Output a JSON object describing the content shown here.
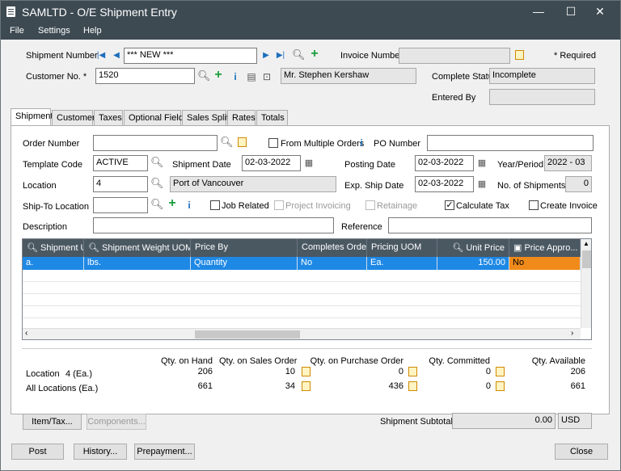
{
  "window": {
    "title": "SAMLTD - O/E Shipment Entry",
    "minimize": "—",
    "maximize": "☐",
    "close": "✕"
  },
  "menu": {
    "file": "File",
    "settings": "Settings",
    "help": "Help"
  },
  "header": {
    "shipment_number_label": "Shipment Number",
    "shipment_number_value": "*** NEW ***",
    "invoice_number_label": "Invoice Number",
    "invoice_number_value": "",
    "required_label": "*  Required",
    "customer_no_label": "Customer No. *",
    "customer_no_value": "1520",
    "customer_name": "Mr. Stephen Kershaw",
    "complete_status_label": "Complete Status",
    "complete_status_value": "Incomplete",
    "entered_by_label": "Entered By",
    "entered_by_value": ""
  },
  "tabs": [
    "Shipment",
    "Customer",
    "Taxes",
    "Optional Fields",
    "Sales Split",
    "Rates",
    "Totals"
  ],
  "form": {
    "order_number_label": "Order Number",
    "order_number_value": "",
    "from_multiple_orders": "From Multiple Orders",
    "po_number_label": "PO Number",
    "po_number_value": "",
    "template_code_label": "Template Code",
    "template_code_value": "ACTIVE",
    "shipment_date_label": "Shipment Date",
    "shipment_date_value": "02-03-2022",
    "posting_date_label": "Posting Date",
    "posting_date_value": "02-03-2022",
    "year_period_label": "Year/Period",
    "year_period_value": "2022 - 03",
    "location_label": "Location",
    "location_value": "4",
    "location_name": "Port of Vancouver",
    "exp_ship_date_label": "Exp. Ship Date",
    "exp_ship_date_value": "02-03-2022",
    "no_shipments_label": "No. of Shipments",
    "no_shipments_value": "0",
    "ship_to_label": "Ship-To Location",
    "ship_to_value": "",
    "job_related": "Job Related",
    "project_invoicing": "Project Invoicing",
    "retainage": "Retainage",
    "calculate_tax": "Calculate Tax",
    "create_invoice": "Create Invoice",
    "description_label": "Description",
    "description_value": "",
    "reference_label": "Reference",
    "reference_value": ""
  },
  "grid": {
    "columns": [
      "Shipment U...",
      "Shipment Weight UOM",
      "Price By",
      "Completes Order",
      "Pricing UOM",
      "Unit Price",
      "Price Appro..."
    ],
    "row": [
      "a.",
      "lbs.",
      "Quantity",
      "No",
      "Ea.",
      "150.00",
      "No"
    ]
  },
  "summary": {
    "headers": [
      "Qty. on Hand",
      "Qty. on Sales Order",
      "Qty. on Purchase Order",
      "Qty. Committed",
      "Qty. Available"
    ],
    "location_label": "Location",
    "location_value": "4 (Ea.)",
    "location_values": [
      "206",
      "10",
      "0",
      "0",
      "206"
    ],
    "all_label": "All Locations (Ea.)",
    "all_values": [
      "661",
      "34",
      "436",
      "0",
      "661"
    ]
  },
  "buttons": {
    "item_tax": "Item/Tax...",
    "components": "Components...",
    "post": "Post",
    "history": "History...",
    "prepayment": "Prepayment...",
    "close": "Close"
  },
  "subtotal": {
    "label": "Shipment Subtotal",
    "value": "0.00",
    "currency": "USD"
  }
}
